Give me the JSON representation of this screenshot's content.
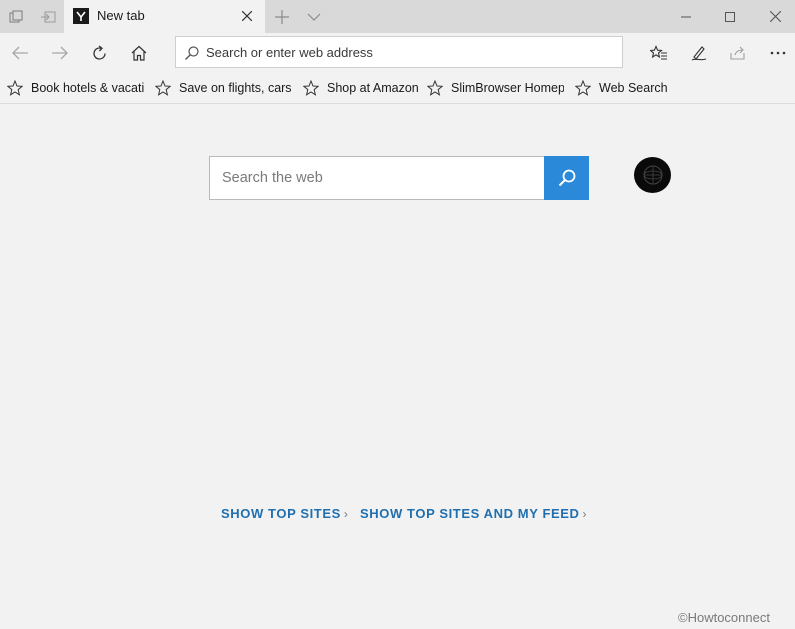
{
  "titlebar": {
    "tab_title": "New tab"
  },
  "navbar": {
    "address_placeholder": "Search or enter web address"
  },
  "favorites": [
    {
      "label": "Book hotels & vacatic"
    },
    {
      "label": "Save on flights, cars &"
    },
    {
      "label": "Shop at Amazon"
    },
    {
      "label": "SlimBrowser Homepa"
    },
    {
      "label": "Web Search"
    }
  ],
  "content": {
    "search_placeholder": "Search the web",
    "show_top_sites": "SHOW TOP SITES",
    "show_top_sites_feed": "SHOW TOP SITES AND MY FEED",
    "chevron": "›"
  },
  "watermark": "©Howtoconnect",
  "colors": {
    "accent": "#2b89d9",
    "link": "#1f6fb0",
    "titlebar": "#d9d9d9",
    "page": "#f2f2f2"
  }
}
